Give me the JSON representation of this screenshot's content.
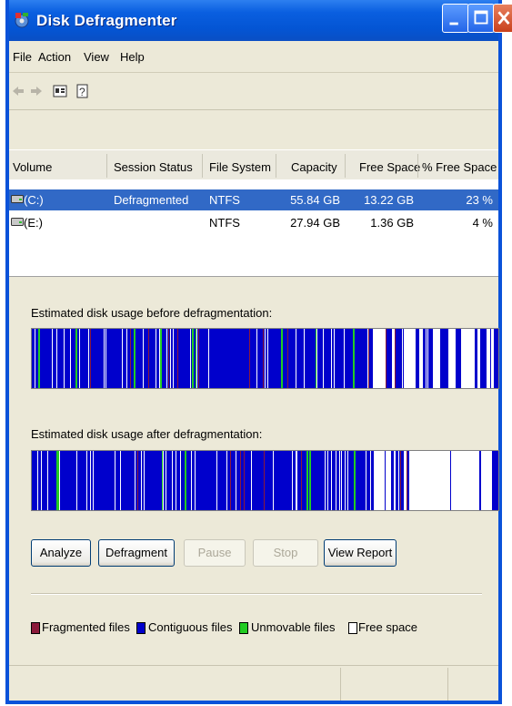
{
  "window": {
    "title": "Disk Defragmenter"
  },
  "menu": [
    "File",
    "Action",
    "View",
    "Help"
  ],
  "toolbar": {
    "icons": [
      "back-arrow-icon",
      "forward-arrow-icon",
      "properties-icon",
      "help-icon"
    ]
  },
  "columns": [
    "Volume",
    "Session Status",
    "File System",
    "Capacity",
    "Free Space",
    "% Free Space"
  ],
  "volumes": [
    {
      "volume": "(C:)",
      "status": "Defragmented",
      "fs": "NTFS",
      "capacity": "55.84 GB",
      "free": "13.22 GB",
      "pct": "23 %",
      "selected": true
    },
    {
      "volume": "(E:)",
      "status": "",
      "fs": "NTFS",
      "capacity": "27.94 GB",
      "free": "1.36 GB",
      "pct": "4 %",
      "selected": false
    }
  ],
  "labels": {
    "before": "Estimated disk usage before defragmentation:",
    "after": "Estimated disk usage after defragmentation:"
  },
  "buttons": {
    "analyze": "Analyze",
    "defragment": "Defragment",
    "pause": "Pause",
    "stop": "Stop",
    "report": "View Report"
  },
  "legend": {
    "fragmented": "Fragmented files",
    "contiguous": "Contiguous files",
    "unmovable": "Unmovable files",
    "free": "Free space"
  },
  "colors": {
    "fragmented": "#8B1A3A",
    "contiguous": "#0000CC",
    "unmovable": "#22CC22",
    "free": "#FFFFFF",
    "selection": "#3169C6"
  }
}
